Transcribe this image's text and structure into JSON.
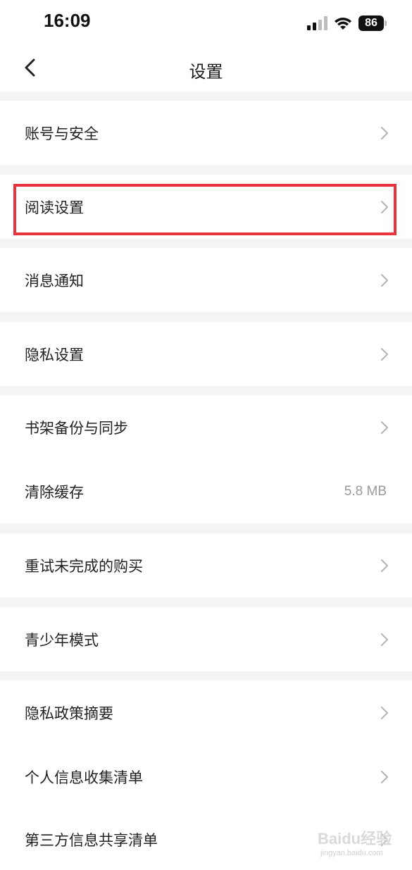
{
  "status_bar": {
    "time": "16:09",
    "battery": "86",
    "icons": [
      "signal-icon",
      "wifi-icon",
      "battery-icon"
    ]
  },
  "nav": {
    "title": "设置",
    "back_icon": "chevron-left-icon"
  },
  "settings": {
    "items": [
      {
        "label": "账号与安全",
        "icon": "chevron-right-icon"
      },
      {
        "label": "阅读设置",
        "icon": "chevron-right-icon"
      },
      {
        "label": "消息通知",
        "icon": "chevron-right-icon"
      },
      {
        "label": "隐私设置",
        "icon": "chevron-right-icon"
      },
      {
        "label": "书架备份与同步",
        "icon": "chevron-right-icon"
      },
      {
        "label": "清除缓存",
        "value": "5.8 MB"
      },
      {
        "label": "重试未完成的购买",
        "icon": "chevron-right-icon"
      },
      {
        "label": "青少年模式",
        "icon": "chevron-right-icon"
      },
      {
        "label": "隐私政策摘要",
        "icon": "chevron-right-icon"
      },
      {
        "label": "个人信息收集清单",
        "icon": "chevron-right-icon"
      },
      {
        "label": "第三方信息共享清单",
        "icon": "chevron-right-icon"
      }
    ]
  },
  "highlight": {
    "color": "#e8323c"
  },
  "watermark": {
    "main": "Baidu经验",
    "sub": "jingyan.baidu.com"
  }
}
